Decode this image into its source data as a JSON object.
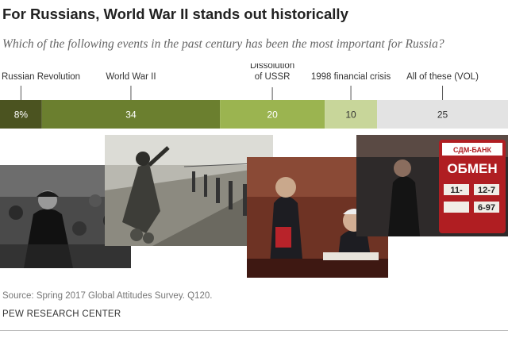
{
  "header": {
    "title": "For Russians, World War II stands out historically",
    "subtitle": "Which of the following events in the past century has been the most important for Russia?"
  },
  "chart_data": {
    "type": "bar",
    "orientation": "horizontal-stacked",
    "series": [
      {
        "name": "Russian Revolution",
        "value": 8,
        "value_label": "8%",
        "color": "#4b5320",
        "text_color": "#ffffff"
      },
      {
        "name": "World War II",
        "value": 34,
        "value_label": "34",
        "color": "#6b7f2f",
        "text_color": "#ffffff"
      },
      {
        "name": "Dissolution of USSR",
        "value": 20,
        "value_label": "20",
        "color": "#9bb450",
        "text_color": "#ffffff"
      },
      {
        "name": "1998 financial crisis",
        "value": 10,
        "value_label": "10",
        "color": "#c8d69a",
        "text_color": "#333333"
      },
      {
        "name": "All of these (VOL)",
        "value": 25,
        "value_label": "25",
        "color": "#e3e3e3",
        "text_color": "#333333"
      }
    ],
    "category_labels": [
      "Russian Revolution",
      "World War II",
      "Dissolution\nof USSR",
      "1998 financial crisis",
      "All of these (VOL)"
    ],
    "legend": "labels above segments with leader lines"
  },
  "photos": [
    {
      "name": "revolution-photo",
      "tone": "#3a3a3a"
    },
    {
      "name": "ww2-photo",
      "tone": "#8a8a84"
    },
    {
      "name": "ussr-photo",
      "tone": "#6e3324"
    },
    {
      "name": "crisis-photo",
      "tone": "#2e2a2a"
    }
  ],
  "footer": {
    "source": "Source: Spring 2017 Global Attitudes Survey. Q120.",
    "org": "PEW RESEARCH CENTER"
  }
}
